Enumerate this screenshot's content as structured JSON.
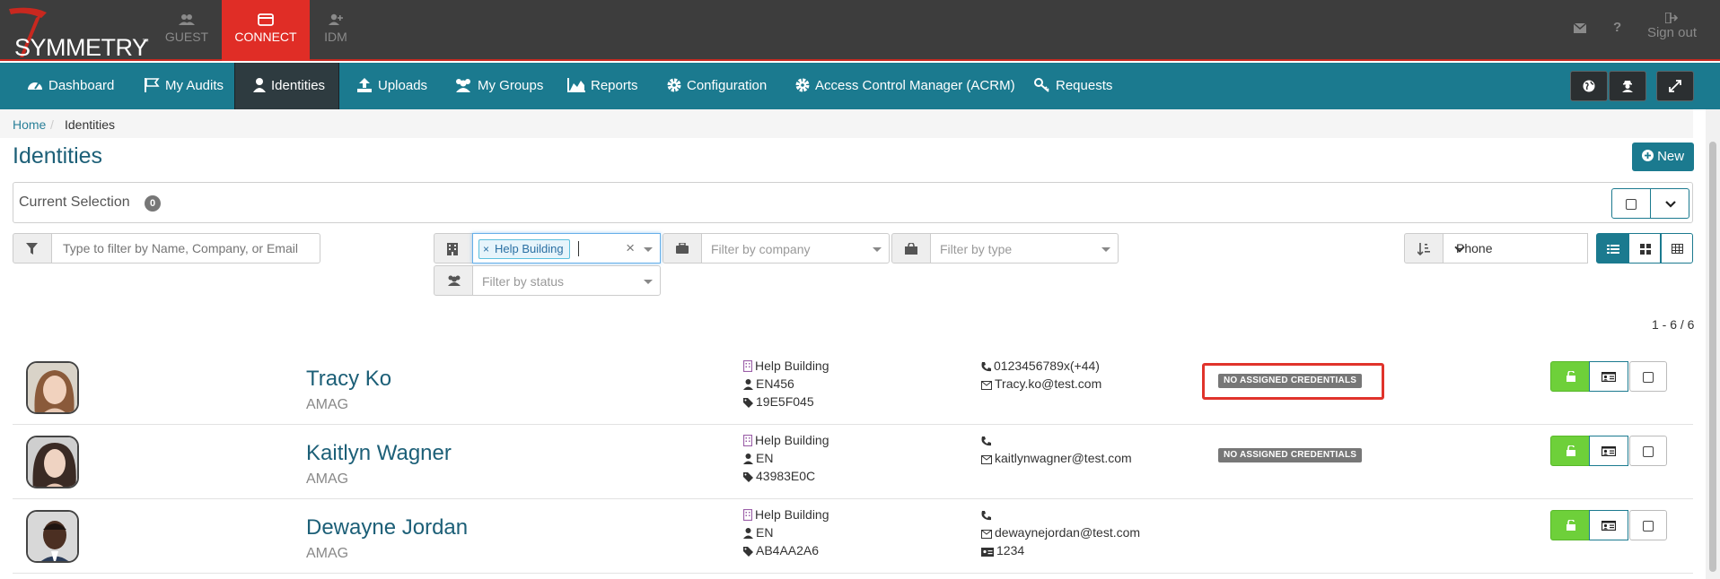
{
  "app": {
    "logo_text": "SYMMETRY",
    "logo_tm": "™"
  },
  "topnav": {
    "items": [
      {
        "label": "GUEST",
        "icon": "users-icon"
      },
      {
        "label": "CONNECT",
        "icon": "card-icon",
        "active": true
      },
      {
        "label": "IDM",
        "icon": "user-plus-icon"
      }
    ],
    "sign_out": "Sign out",
    "accent": "#e02d26"
  },
  "mainnav": {
    "items": [
      {
        "label": "Dashboard",
        "icon": "dashboard-icon"
      },
      {
        "label": "My Audits",
        "icon": "flag-icon"
      },
      {
        "label": "Identities",
        "icon": "user-icon",
        "active": true
      },
      {
        "label": "Uploads",
        "icon": "upload-icon"
      },
      {
        "label": "My Groups",
        "icon": "users-icon"
      },
      {
        "label": "Reports",
        "icon": "area-chart-icon"
      },
      {
        "label": "Configuration",
        "icon": "gear-icon"
      },
      {
        "label": "Access Control Manager (ACRM)",
        "icon": "gear-icon"
      },
      {
        "label": "Requests",
        "icon": "key-icon"
      }
    ],
    "color": "#1b7a8f"
  },
  "breadcrumb": {
    "home": "Home",
    "separator": "/",
    "current": "Identities"
  },
  "page": {
    "title": "Identities",
    "new_label": "New"
  },
  "current_selection": {
    "label": "Current Selection",
    "count": "0"
  },
  "filters": {
    "name_placeholder": "Type to filter by Name, Company, or Email",
    "building_tag": "Help Building",
    "company_placeholder": "Filter by company",
    "type_placeholder": "Filter by type",
    "status_placeholder": "Filter by status",
    "sort_value": "Phone"
  },
  "paging": "1 - 6 / 6",
  "identities": [
    {
      "name": "Tracy Ko",
      "company": "AMAG",
      "building": "Help Building",
      "code": "EN456",
      "tag": "19E5F045",
      "phone": "0123456789x(+44)",
      "email": "Tracy.ko@test.com",
      "card": "",
      "status": "NO ASSIGNED CREDENTIALS"
    },
    {
      "name": "Kaitlyn Wagner",
      "company": "AMAG",
      "building": "Help Building",
      "code": "EN",
      "tag": "43983E0C",
      "phone": "",
      "email": "kaitlynwagner@test.com",
      "card": "",
      "status": "NO ASSIGNED CREDENTIALS"
    },
    {
      "name": "Dewayne Jordan",
      "company": "AMAG",
      "building": "Help Building",
      "code": "EN",
      "tag": "AB4AA2A6",
      "phone": "",
      "email": "dewaynejordan@test.com",
      "card": "1234",
      "status": ""
    }
  ]
}
